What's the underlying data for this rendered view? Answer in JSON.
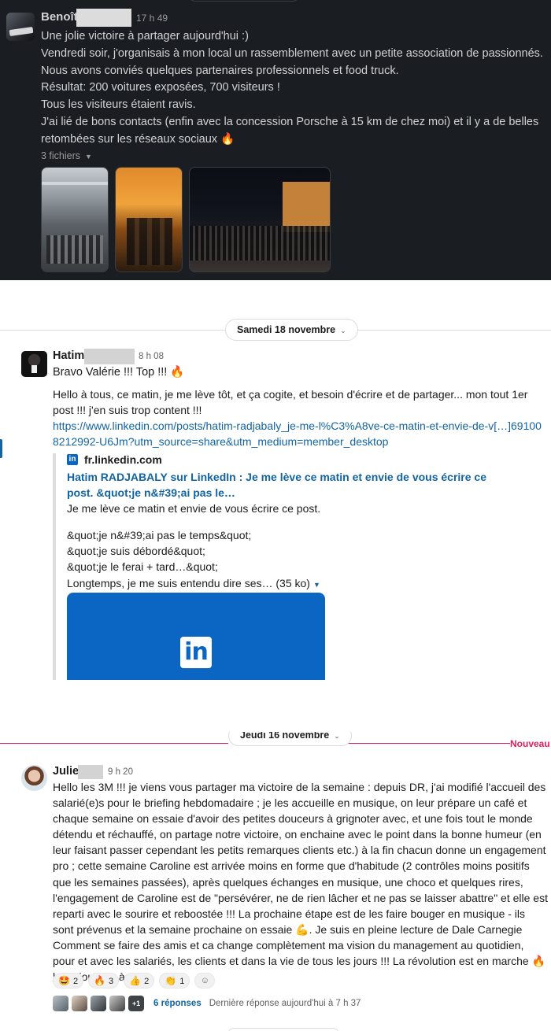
{
  "panel1": {
    "author": "Benoît",
    "time": "17 h 49",
    "lines": [
      "Une jolie victoire à partager aujourd'hui :)",
      "Vendredi soir, j'organisais à mon local un rassemblement avec un petite association de passionnés.",
      "Nous avons conviés quelques partenaires professionnels et food truck.",
      "Résultat: 200 voitures exposées, 700 visiteurs !",
      "Tous les visiteurs étaient ravis.",
      "J'ai lié de bons contacts (enfin avec la concession Porsche à 15 km de chez moi) et il y a de belles retombées sur les réseaux sociaux 🔥"
    ],
    "files_label": "3 fichiers"
  },
  "panel2": {
    "date": "Samedi 18 novembre",
    "author": "Hatim",
    "time": "8 h 08",
    "line1": "Bravo Valérie !!! Top !!! 🔥",
    "paragraph": "Hello à tous, ce matin, je me lève tôt, et ça cogite, et besoin d'écrire et de partager... mon tout 1er post !!! j'en suis trop content !!!",
    "link": "https://www.linkedin.com/posts/hatim-radjabaly_je-me-l%C3%A8ve-ce-matin-et-envie-de-v[…]691008212992-U6Jm?utm_source=share&utm_medium=member_desktop",
    "unfurl": {
      "source": "fr.linkedin.com",
      "title": "Hatim RADJABALY sur LinkedIn : Je me lève ce matin et envie de vous écrire ce post. &quot;je n&#39;ai pas le…",
      "description": "Je me lève ce matin et envie de vous écrire ce post.",
      "quotes": [
        "&quot;je n&#39;ai pas le temps&quot;",
        "&quot;je suis débordé&quot;",
        "&quot;je le ferai + tard…&quot;"
      ],
      "more": "Longtemps, je me suis entendu dire ses… (35 ko)",
      "logo_text": "in"
    }
  },
  "panel3": {
    "date": "Jeudi 16 novembre",
    "new_label": "Nouveau",
    "author": "Julie",
    "time": "9 h 20",
    "body": "Hello les 3M !!! je viens vous partager ma victoire de la semaine : depuis DR, j'ai modifié l'accueil des salarié(e)s pour le briefing hebdomadaire ; je les accueille en musique, on leur prépare un café et chaque semaine on essaie d'avoir des petites douceurs à grignoter avec, et une fois tout le monde détendu et réchauffé, on partage notre victoire, on enchaine avec le point dans la bonne humeur (en leur faisant passer cependant les petits remarques clients etc.) à la fin chacun donne un engagement pro ; cette semaine Caroline est arrivée moins en forme que d'habitude (2 contrôles moins positifs que les semaines passées), après quelques échanges en musique, une choco et quelques rires, l'engagement de Caroline est de \"persévérer, ne de rien lâcher et ne pas se laisser abattre\" et elle est reparti avec le sourire et reboostée !!! La prochaine étape est de les faire bouger en musique - ils sont prévenus et la semaine prochaine on essaie 💪. Je suis en pleine lecture de Dale Carnegie Comment se faire des amis et ca change complètement ma vision du management au quotidien, pour et avec les salariés, les clients et dans la vie de tous les jours !!!  La révolution est en marche 🔥 belle journée à tous",
    "reactions": [
      {
        "emoji": "🤩",
        "count": "2"
      },
      {
        "emoji": "🔥",
        "count": "3"
      },
      {
        "emoji": "👍",
        "count": "2"
      },
      {
        "emoji": "👏",
        "count": "1"
      }
    ],
    "thread_more": "+1",
    "replies": "6 réponses",
    "last_reply": "Dernière réponse aujourd'hui à 7 h 37"
  }
}
